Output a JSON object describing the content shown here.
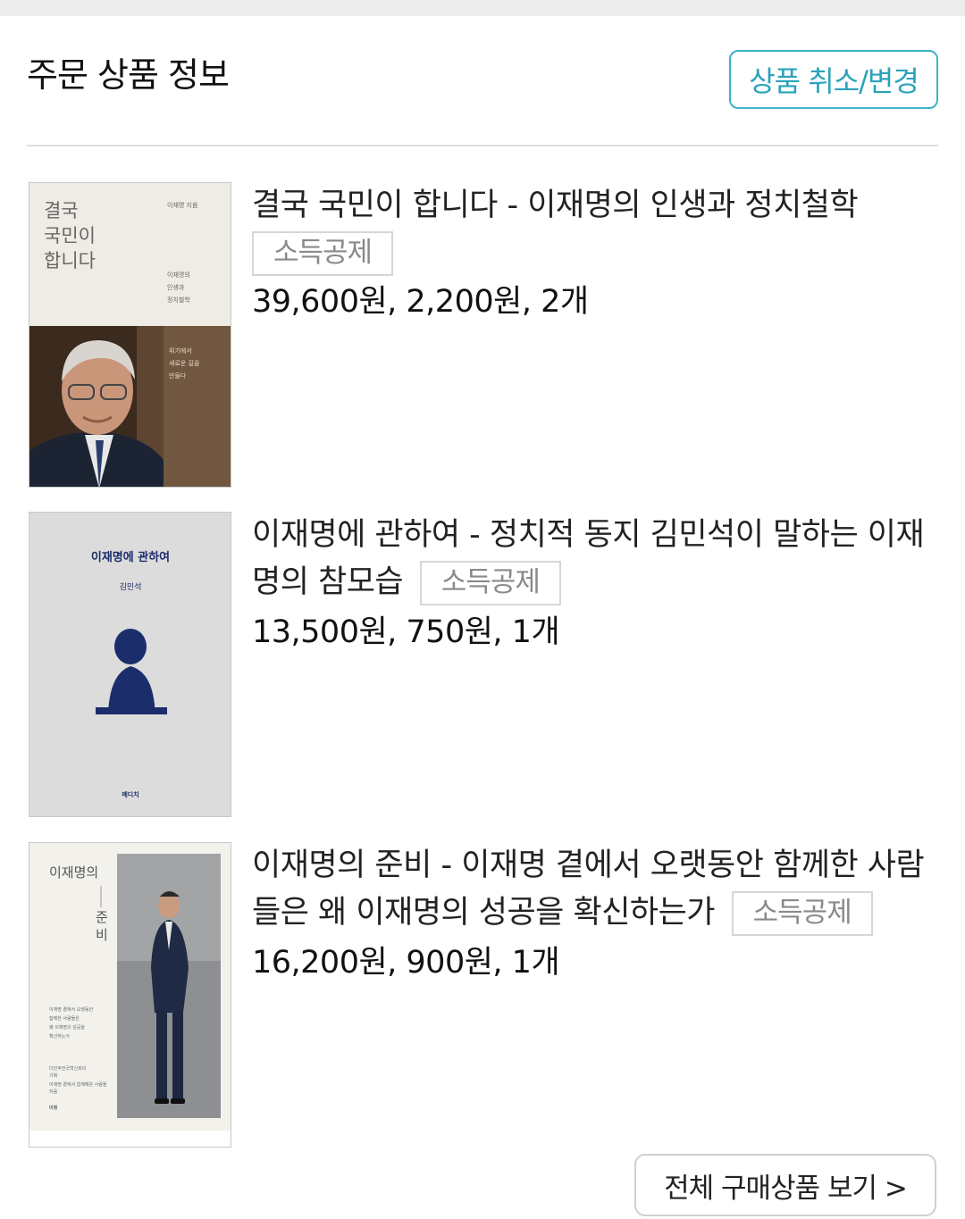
{
  "header": {
    "title": "주문 상품 정보",
    "cancel_change_label": "상품 취소/변경"
  },
  "items": [
    {
      "title": "결국 국민이 합니다 - 이재명의 인생과 정치철학",
      "badge": "소득공제",
      "price_line": "39,600원, 2,200원, 2개",
      "cover": {
        "title_lines": [
          "결국",
          "국민이",
          "합니다"
        ],
        "author": "이재명 지음",
        "subtitle_lines": [
          "이재명의",
          "인생과",
          "정치철학"
        ],
        "tagline_lines": [
          "위기에서",
          "새로운 길을",
          "만들다"
        ]
      }
    },
    {
      "title": "이재명에 관하여 - 정치적 동지 김민석이 말하는 이재명의 참모습",
      "badge": "소득공제",
      "price_line": "13,500원, 750원, 1개",
      "cover": {
        "title": "이재명에 관하여",
        "author": "김민석",
        "publisher": "메디치"
      }
    },
    {
      "title": "이재명의 준비 - 이재명 곁에서 오랫동안 함께한 사람들은 왜 이재명의 성공을 확신하는가",
      "badge": "소득공제",
      "price_line": "16,200원, 900원, 1개",
      "cover": {
        "title": "이재명의",
        "title_vertical": [
          "준",
          "비"
        ],
        "desc_lines": [
          "이재명 곁에서 오랫동안",
          "함께한 사람들은",
          "왜 이재명의 성공을",
          "확신하는가"
        ],
        "credit_lines": [
          "더민주전국혁신회의",
          "기획",
          "이재명 곁에서 함께해온 사람들",
          "지음"
        ],
        "publisher": "미렝"
      }
    }
  ],
  "footer": {
    "view_all_label": "전체 구매상품 보기 >"
  }
}
